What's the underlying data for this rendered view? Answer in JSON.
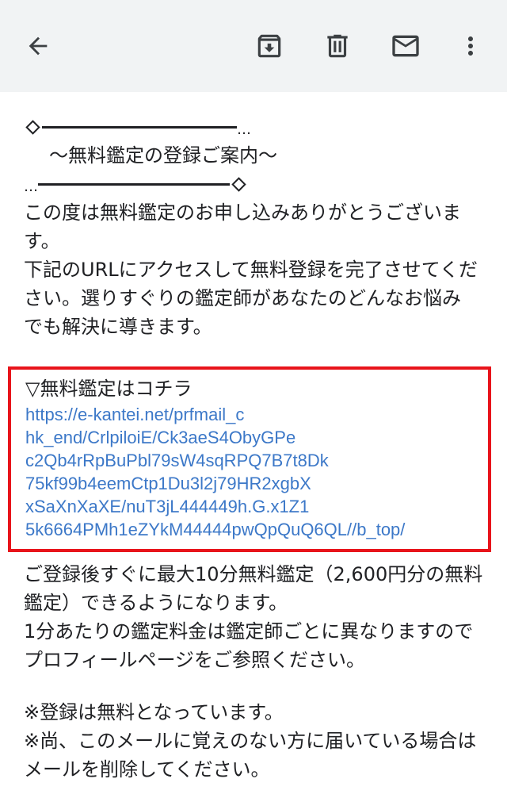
{
  "toolbar": {
    "back_icon": "arrow-left-icon",
    "archive_icon": "archive-icon",
    "delete_icon": "trash-icon",
    "mark_unread_icon": "mail-icon",
    "more_icon": "more-vert-icon"
  },
  "email": {
    "deco_top_end": "…",
    "title": "〜無料鑑定の登録ご案内〜",
    "deco_bottom_start": "…",
    "intro_lines": [
      "この度は無料鑑定のお申し込みありがとうございま",
      "す。",
      "下記のURLにアクセスして無料登録を完了させてくだ",
      "さい。選りすぐりの鑑定師があなたのどんなお悩み",
      "でも解決に導きます。"
    ],
    "link_heading": "▽無料鑑定はコチラ",
    "link_lines": [
      "https://e-kantei.net/prfmail_c",
      "hk_end/CrlpiloiE/Ck3aeS4ObyGPe",
      "c2Qb4rRpBuPbl79sW4sqRPQ7B7t8Dk",
      "75kf99b4eemCtp1Du3l2j79HR2xgbX",
      "xSaXnXaXE/nuT3jL444449h.G.x1Z1",
      "5k6664PMh1eZYkM44444pwQpQuQ6QL//b_top/"
    ],
    "after_lines": [
      "ご登録後すぐに最大10分無料鑑定（2,600円分の無料",
      "鑑定）できるようになります。",
      "1分あたりの鑑定料金は鑑定師ごとに異なりますので",
      "プロフィールページをご参照ください。"
    ],
    "note_lines": [
      "※登録は無料となっています。",
      "※尚、このメールに覚えのない方に届いている場合は",
      "メールを削除してください。"
    ]
  },
  "colors": {
    "toolbar_bg": "#f1f3f4",
    "link": "#3c78c8",
    "highlight_border": "#e8141b"
  }
}
